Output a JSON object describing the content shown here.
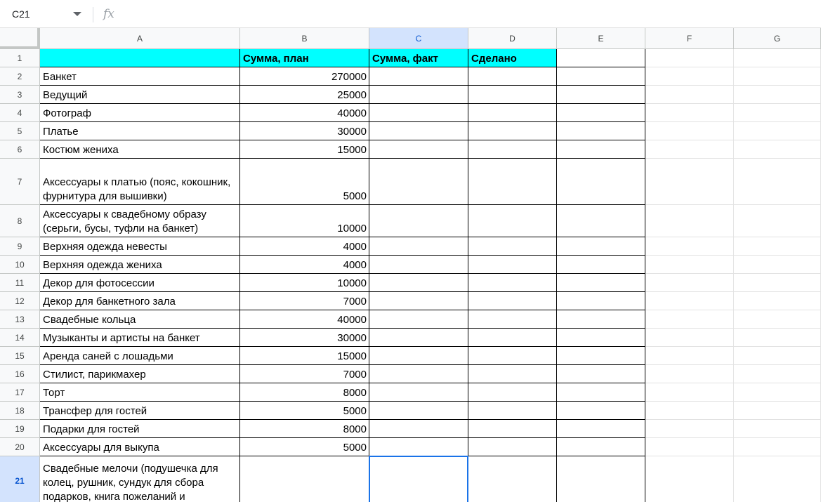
{
  "formula_bar": {
    "cell_ref": "C21",
    "fx_label": "fx",
    "value": ""
  },
  "columns": [
    "A",
    "B",
    "C",
    "D",
    "E",
    "F",
    "G"
  ],
  "selected_column": "C",
  "selected_row": "21",
  "header_row": {
    "row_number": "1",
    "cells": [
      "",
      "Сумма, план",
      "Сумма, факт",
      "Сделано"
    ]
  },
  "rows": [
    {
      "num": "2",
      "item": "Банкет",
      "plan": "270000"
    },
    {
      "num": "3",
      "item": "Ведущий",
      "plan": "25000"
    },
    {
      "num": "4",
      "item": "Фотограф",
      "plan": "40000"
    },
    {
      "num": "5",
      "item": "Платье",
      "plan": "30000"
    },
    {
      "num": "6",
      "item": "Костюм жениха",
      "plan": "15000"
    },
    {
      "num": "7",
      "item": "Аксессуары к платью (пояс, кокошник, фурнитура для вышивки)",
      "plan": "5000"
    },
    {
      "num": "8",
      "item": "Аксессуары к свадебному образу (серьги, бусы, туфли на банкет)",
      "plan": "10000"
    },
    {
      "num": "9",
      "item": "Верхняя одежда невесты",
      "plan": "4000"
    },
    {
      "num": "10",
      "item": "Верхняя одежда жениха",
      "plan": "4000"
    },
    {
      "num": "11",
      "item": "Декор для фотосессии",
      "plan": "10000"
    },
    {
      "num": "12",
      "item": "Декор для банкетного зала",
      "plan": "7000"
    },
    {
      "num": "13",
      "item": "Свадебные кольца",
      "plan": "40000"
    },
    {
      "num": "14",
      "item": "Музыканты и артисты на банкет",
      "plan": "30000"
    },
    {
      "num": "15",
      "item": "Аренда саней с лошадьми",
      "plan": "15000"
    },
    {
      "num": "16",
      "item": "Стилист, парикмахер",
      "plan": "7000"
    },
    {
      "num": "17",
      "item": "Торт",
      "plan": "8000"
    },
    {
      "num": "18",
      "item": "Трансфер для гостей",
      "plan": "5000"
    },
    {
      "num": "19",
      "item": "Подарки для гостей",
      "plan": "8000"
    },
    {
      "num": "20",
      "item": "Аксессуары для выкупа",
      "plan": "5000"
    },
    {
      "num": "21",
      "item": "Свадебные мелочи (подушечка для колец, рушник, сундук для сбора подарков, книга пожеланий и",
      "plan": ""
    }
  ],
  "colors": {
    "header_fill": "#00ffff",
    "selection_accent": "#1a73e8",
    "header_selected_bg": "#d3e3fd"
  }
}
